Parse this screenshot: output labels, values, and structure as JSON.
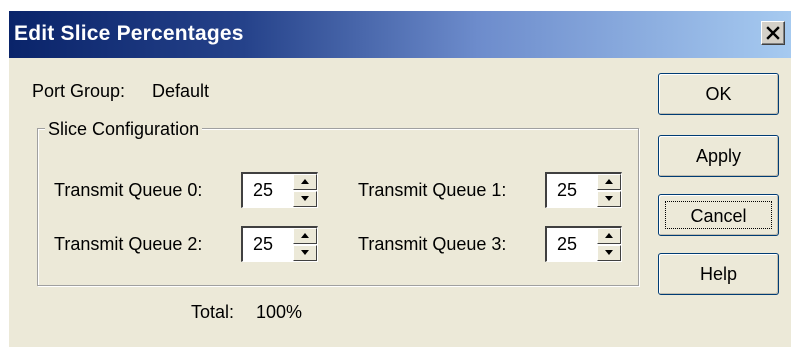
{
  "window": {
    "title": "Edit Slice Percentages",
    "close_glyph": "×"
  },
  "port_group": {
    "label": "Port Group:",
    "value": "Default"
  },
  "slice_config": {
    "legend": "Slice Configuration",
    "queues": [
      {
        "label": "Transmit Queue 0:",
        "value": "25"
      },
      {
        "label": "Transmit Queue 1:",
        "value": "25"
      },
      {
        "label": "Transmit Queue 2:",
        "value": "25"
      },
      {
        "label": "Transmit Queue 3:",
        "value": "25"
      }
    ]
  },
  "total": {
    "label": "Total:",
    "value": "100%"
  },
  "buttons": {
    "ok": "OK",
    "apply": "Apply",
    "cancel": "Cancel",
    "help": "Help"
  },
  "icons": {
    "close": "close-icon",
    "spin_up": "arrow-up-icon",
    "spin_down": "arrow-down-icon"
  },
  "colors": {
    "titlebar_start": "#0a246a",
    "titlebar_end": "#a6caf0",
    "dialog_background": "#ece9d8"
  }
}
